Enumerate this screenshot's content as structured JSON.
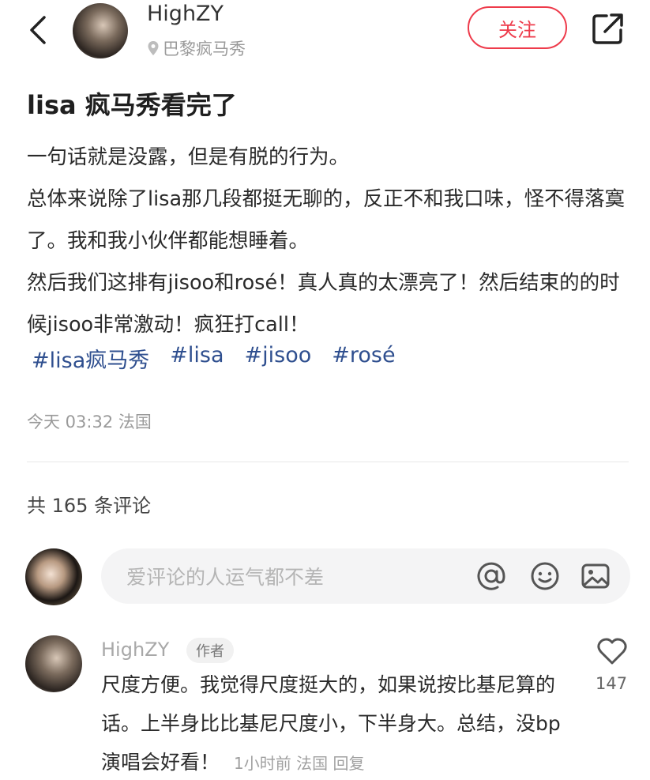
{
  "header": {
    "author_name": "HighZY",
    "location": "巴黎疯马秀",
    "follow_label": "关注",
    "icons": {
      "back": "chevron-left-icon",
      "share": "share-icon",
      "location": "location-pin-icon"
    }
  },
  "post": {
    "title": "lisa 疯马秀看完了",
    "paragraphs": [
      "一句话就是没露，但是有脱的行为。",
      "总体来说除了lisa那几段都挺无聊的，反正不和我口味，怪不得落寞了。我和我小伙伴都能想睡着。",
      "然后我们这排有jisoo和rosé！真人真的太漂亮了！然后结束的的时候jisoo非常激动！疯狂打call！"
    ],
    "tags": [
      "#lisa疯马秀",
      "#lisa",
      "#jisoo",
      "#rosé"
    ],
    "meta": "今天 03:32 法国"
  },
  "comments": {
    "count_label": "共 165 条评论",
    "input_placeholder": "爱评论的人运气都不差",
    "input_icons": [
      "at-icon",
      "emoji-icon",
      "image-icon"
    ],
    "items": [
      {
        "author": "HighZY",
        "badge": "作者",
        "text": "尺度方便。我觉得尺度挺大的，如果说按比基尼算的话。上半身比比基尼尺度小，下半身大。总结，没bp演唱会好看！",
        "time": "1小时前",
        "location": "法国",
        "reply_label": "回复",
        "likes": "147"
      }
    ]
  },
  "colors": {
    "accent": "#ee3b4b",
    "tag": "#2f4f8f",
    "muted": "#9a9a9a"
  }
}
